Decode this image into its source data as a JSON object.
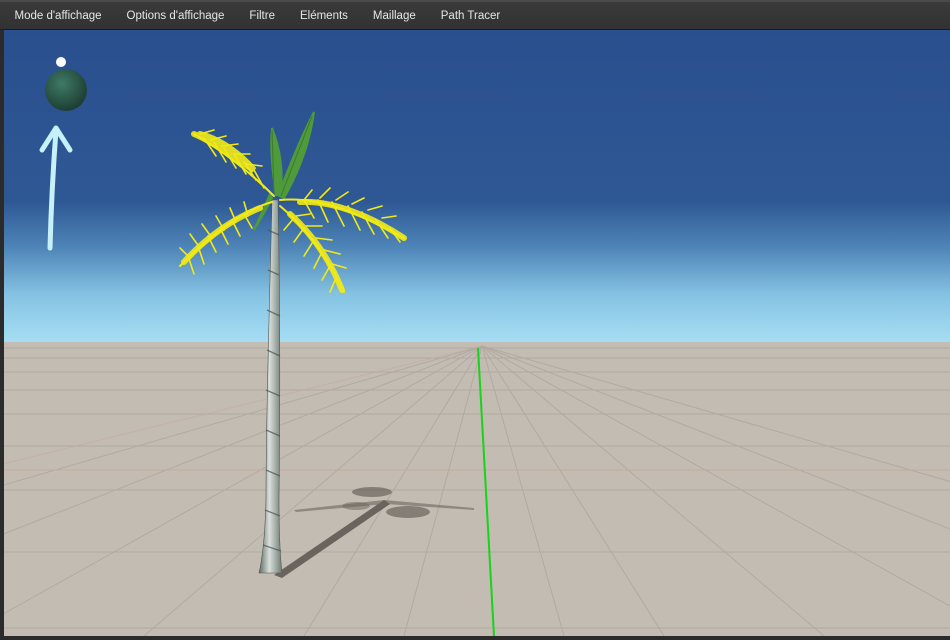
{
  "menu": {
    "items": [
      {
        "id": "display-mode",
        "label": "Mode d'affichage"
      },
      {
        "id": "display-options",
        "label": "Options d'affichage"
      },
      {
        "id": "filter",
        "label": "Filtre"
      },
      {
        "id": "elements",
        "label": "Eléments"
      },
      {
        "id": "mesh",
        "label": "Maillage"
      },
      {
        "id": "path-tracer",
        "label": "Path Tracer"
      }
    ]
  },
  "viewport": {
    "sky_top_color": "#2a4f8e",
    "sky_horizon_color": "#a6ddf3",
    "ground_color": "#c3bcb3",
    "axis_color": "#18d418",
    "sun_widget_color": "#2d5a4a",
    "sun_arrow_color": "#c6f1f9",
    "palm_frond_color": "#f1ea16",
    "palm_frond_back_color": "#4f9a3a"
  }
}
